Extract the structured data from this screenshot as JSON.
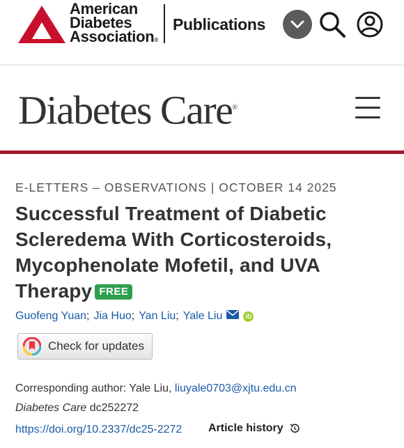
{
  "header": {
    "org_lines": [
      "American",
      "Diabetes",
      "Association"
    ],
    "registered_mark": "®",
    "publications_label": "Publications",
    "icons": [
      "chevron-down-icon",
      "search-icon",
      "user-icon"
    ]
  },
  "journal": {
    "title": "Diabetes Care",
    "registered_mark": "®",
    "menu_icon": "hamburger-menu-icon"
  },
  "article": {
    "category": "E-LETTERS – OBSERVATIONS",
    "date": "OCTOBER 14 2025",
    "title": "Successful Treatment of Diabetic Scleredema With Corticosteroids, Mycophenolate Mofetil, and UVA Therapy",
    "free_badge": "FREE",
    "authors": [
      "Guofeng Yuan",
      "Jia Huo",
      "Yan Liu",
      "Yale Liu"
    ],
    "author_separator": ";",
    "check_updates_label": "Check for updates",
    "corresponding_prefix": "Corresponding author: Yale Liu,",
    "corresponding_email": "liuyale0703@xjtu.edu.cn",
    "citation_journal": "Diabetes Care",
    "citation_id": "dc252272",
    "doi": "https://doi.org/10.2337/dc25-2272",
    "history_label": "Article history"
  },
  "colors": {
    "ada_red": "#c8102e",
    "rule_red": "#a6192e",
    "link_blue": "#1a5aa6",
    "free_green": "#2e9f4e",
    "orcid_green": "#a6ce39"
  }
}
